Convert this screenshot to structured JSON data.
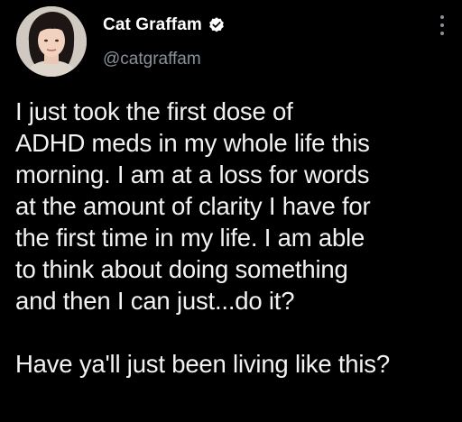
{
  "tweet": {
    "author": {
      "display_name": "Cat Graffam",
      "handle": "@catgraffam",
      "verified": true
    },
    "text": "I just took the first dose of\nADHD meds in my whole life this\nmorning. I am at a loss for words\nat the amount of clarity I have for\nthe first time in my life. I am able\nto think about doing something\nand then I can just...do it?\n\nHave ya'll just been living like this?",
    "icons": {
      "verified": "verified-badge-icon",
      "more": "more-options-icon"
    }
  },
  "colors": {
    "background": "#000000",
    "text": "#f2f2f2",
    "secondary_text": "#8a9099",
    "verified_badge": "#ffffff"
  }
}
